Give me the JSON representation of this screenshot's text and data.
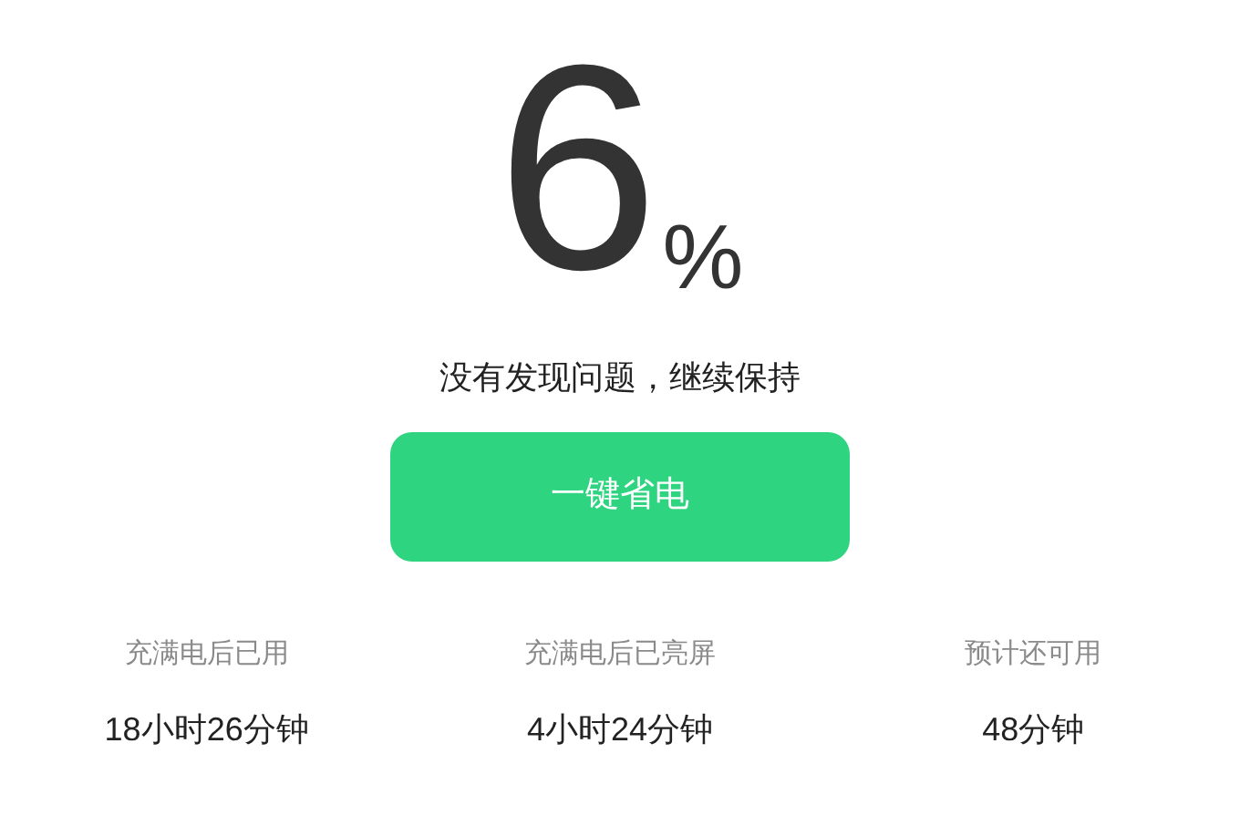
{
  "battery": {
    "percent": "6",
    "unit": "%"
  },
  "status_message": "没有发现问题，继续保持",
  "optimize_button": "一键省电",
  "stats": [
    {
      "label": "充满电后已用",
      "value": "18小时26分钟"
    },
    {
      "label": "充满电后已亮屏",
      "value": "4小时24分钟"
    },
    {
      "label": "预计还可用",
      "value": "48分钟"
    }
  ]
}
